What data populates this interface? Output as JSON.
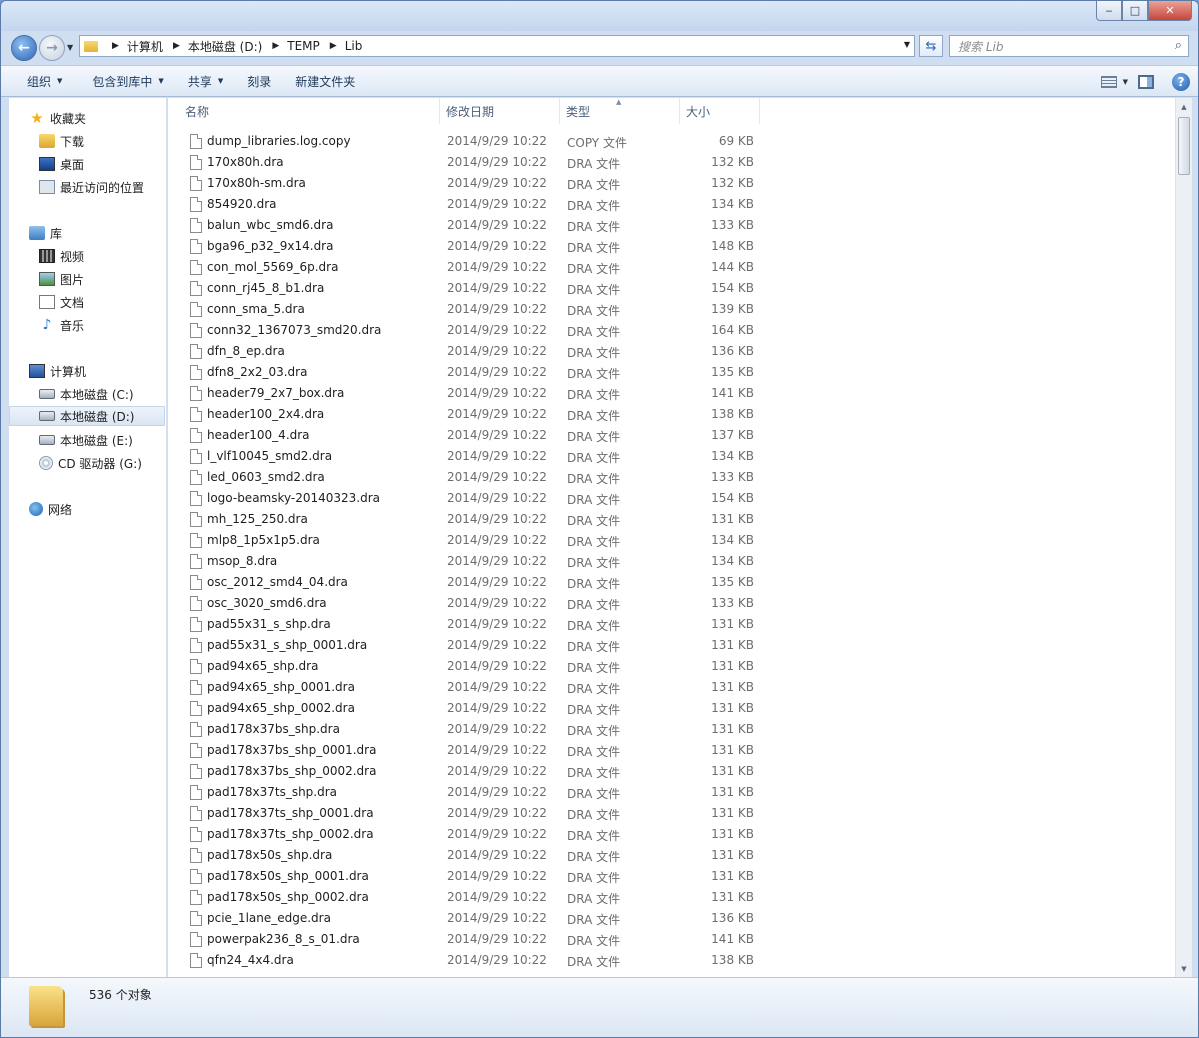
{
  "window": {
    "minimize": "‒",
    "maximize": "□",
    "close": "✕"
  },
  "address": {
    "crumbs": [
      "计算机",
      "本地磁盘 (D:)",
      "TEMP",
      "Lib"
    ],
    "search_placeholder": "搜索 Lib"
  },
  "toolbar": {
    "organize": "组织",
    "include_in_library": "包含到库中",
    "share": "共享",
    "burn": "刻录",
    "new_folder": "新建文件夹"
  },
  "nav": {
    "favorites": {
      "title": "收藏夹",
      "items": [
        "下载",
        "桌面",
        "最近访问的位置"
      ]
    },
    "libraries": {
      "title": "库",
      "items": [
        "视频",
        "图片",
        "文档",
        "音乐"
      ]
    },
    "computer": {
      "title": "计算机",
      "items": [
        "本地磁盘 (C:)",
        "本地磁盘 (D:)",
        "本地磁盘 (E:)",
        "CD 驱动器 (G:)"
      ],
      "selected": "本地磁盘 (D:)"
    },
    "network": {
      "title": "网络"
    }
  },
  "columns": {
    "name": "名称",
    "date": "修改日期",
    "type": "类型",
    "size": "大小"
  },
  "files": [
    {
      "name": "dump_libraries.log.copy",
      "date": "2014/9/29 10:22",
      "type": "COPY 文件",
      "size": "69 KB"
    },
    {
      "name": "170x80h.dra",
      "date": "2014/9/29 10:22",
      "type": "DRA 文件",
      "size": "132 KB"
    },
    {
      "name": "170x80h-sm.dra",
      "date": "2014/9/29 10:22",
      "type": "DRA 文件",
      "size": "132 KB"
    },
    {
      "name": "854920.dra",
      "date": "2014/9/29 10:22",
      "type": "DRA 文件",
      "size": "134 KB"
    },
    {
      "name": "balun_wbc_smd6.dra",
      "date": "2014/9/29 10:22",
      "type": "DRA 文件",
      "size": "133 KB"
    },
    {
      "name": "bga96_p32_9x14.dra",
      "date": "2014/9/29 10:22",
      "type": "DRA 文件",
      "size": "148 KB"
    },
    {
      "name": "con_mol_5569_6p.dra",
      "date": "2014/9/29 10:22",
      "type": "DRA 文件",
      "size": "144 KB"
    },
    {
      "name": "conn_rj45_8_b1.dra",
      "date": "2014/9/29 10:22",
      "type": "DRA 文件",
      "size": "154 KB"
    },
    {
      "name": "conn_sma_5.dra",
      "date": "2014/9/29 10:22",
      "type": "DRA 文件",
      "size": "139 KB"
    },
    {
      "name": "conn32_1367073_smd20.dra",
      "date": "2014/9/29 10:22",
      "type": "DRA 文件",
      "size": "164 KB"
    },
    {
      "name": "dfn_8_ep.dra",
      "date": "2014/9/29 10:22",
      "type": "DRA 文件",
      "size": "136 KB"
    },
    {
      "name": "dfn8_2x2_03.dra",
      "date": "2014/9/29 10:22",
      "type": "DRA 文件",
      "size": "135 KB"
    },
    {
      "name": "header79_2x7_box.dra",
      "date": "2014/9/29 10:22",
      "type": "DRA 文件",
      "size": "141 KB"
    },
    {
      "name": "header100_2x4.dra",
      "date": "2014/9/29 10:22",
      "type": "DRA 文件",
      "size": "138 KB"
    },
    {
      "name": "header100_4.dra",
      "date": "2014/9/29 10:22",
      "type": "DRA 文件",
      "size": "137 KB"
    },
    {
      "name": "l_vlf10045_smd2.dra",
      "date": "2014/9/29 10:22",
      "type": "DRA 文件",
      "size": "134 KB"
    },
    {
      "name": "led_0603_smd2.dra",
      "date": "2014/9/29 10:22",
      "type": "DRA 文件",
      "size": "133 KB"
    },
    {
      "name": "logo-beamsky-20140323.dra",
      "date": "2014/9/29 10:22",
      "type": "DRA 文件",
      "size": "154 KB"
    },
    {
      "name": "mh_125_250.dra",
      "date": "2014/9/29 10:22",
      "type": "DRA 文件",
      "size": "131 KB"
    },
    {
      "name": "mlp8_1p5x1p5.dra",
      "date": "2014/9/29 10:22",
      "type": "DRA 文件",
      "size": "134 KB"
    },
    {
      "name": "msop_8.dra",
      "date": "2014/9/29 10:22",
      "type": "DRA 文件",
      "size": "134 KB"
    },
    {
      "name": "osc_2012_smd4_04.dra",
      "date": "2014/9/29 10:22",
      "type": "DRA 文件",
      "size": "135 KB"
    },
    {
      "name": "osc_3020_smd6.dra",
      "date": "2014/9/29 10:22",
      "type": "DRA 文件",
      "size": "133 KB"
    },
    {
      "name": "pad55x31_s_shp.dra",
      "date": "2014/9/29 10:22",
      "type": "DRA 文件",
      "size": "131 KB"
    },
    {
      "name": "pad55x31_s_shp_0001.dra",
      "date": "2014/9/29 10:22",
      "type": "DRA 文件",
      "size": "131 KB"
    },
    {
      "name": "pad94x65_shp.dra",
      "date": "2014/9/29 10:22",
      "type": "DRA 文件",
      "size": "131 KB"
    },
    {
      "name": "pad94x65_shp_0001.dra",
      "date": "2014/9/29 10:22",
      "type": "DRA 文件",
      "size": "131 KB"
    },
    {
      "name": "pad94x65_shp_0002.dra",
      "date": "2014/9/29 10:22",
      "type": "DRA 文件",
      "size": "131 KB"
    },
    {
      "name": "pad178x37bs_shp.dra",
      "date": "2014/9/29 10:22",
      "type": "DRA 文件",
      "size": "131 KB"
    },
    {
      "name": "pad178x37bs_shp_0001.dra",
      "date": "2014/9/29 10:22",
      "type": "DRA 文件",
      "size": "131 KB"
    },
    {
      "name": "pad178x37bs_shp_0002.dra",
      "date": "2014/9/29 10:22",
      "type": "DRA 文件",
      "size": "131 KB"
    },
    {
      "name": "pad178x37ts_shp.dra",
      "date": "2014/9/29 10:22",
      "type": "DRA 文件",
      "size": "131 KB"
    },
    {
      "name": "pad178x37ts_shp_0001.dra",
      "date": "2014/9/29 10:22",
      "type": "DRA 文件",
      "size": "131 KB"
    },
    {
      "name": "pad178x37ts_shp_0002.dra",
      "date": "2014/9/29 10:22",
      "type": "DRA 文件",
      "size": "131 KB"
    },
    {
      "name": "pad178x50s_shp.dra",
      "date": "2014/9/29 10:22",
      "type": "DRA 文件",
      "size": "131 KB"
    },
    {
      "name": "pad178x50s_shp_0001.dra",
      "date": "2014/9/29 10:22",
      "type": "DRA 文件",
      "size": "131 KB"
    },
    {
      "name": "pad178x50s_shp_0002.dra",
      "date": "2014/9/29 10:22",
      "type": "DRA 文件",
      "size": "131 KB"
    },
    {
      "name": "pcie_1lane_edge.dra",
      "date": "2014/9/29 10:22",
      "type": "DRA 文件",
      "size": "136 KB"
    },
    {
      "name": "powerpak236_8_s_01.dra",
      "date": "2014/9/29 10:22",
      "type": "DRA 文件",
      "size": "141 KB"
    },
    {
      "name": "qfn24_4x4.dra",
      "date": "2014/9/29 10:22",
      "type": "DRA 文件",
      "size": "138 KB"
    }
  ],
  "status": {
    "count": "536 个对象"
  }
}
